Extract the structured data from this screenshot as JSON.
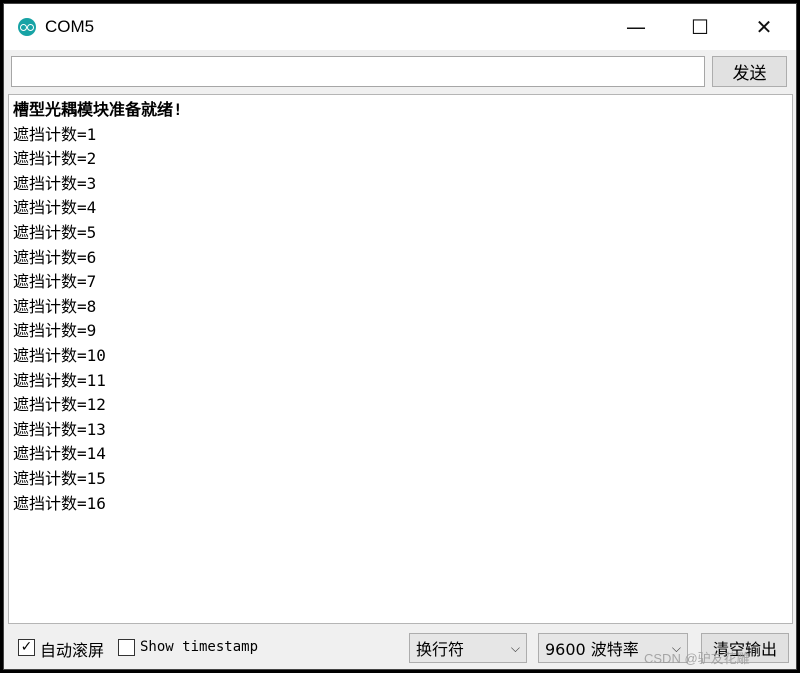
{
  "window": {
    "title": "COM5",
    "app_icon": "arduino-icon",
    "controls": {
      "minimize": "—",
      "maximize": "☐",
      "close": "✕"
    }
  },
  "send": {
    "input_value": "",
    "button_label": "发送"
  },
  "output": {
    "lines": [
      "槽型光耦模块准备就绪!",
      "遮挡计数=1",
      "遮挡计数=2",
      "遮挡计数=3",
      "遮挡计数=4",
      "遮挡计数=5",
      "遮挡计数=6",
      "遮挡计数=7",
      "遮挡计数=8",
      "遮挡计数=9",
      "遮挡计数=10",
      "遮挡计数=11",
      "遮挡计数=12",
      "遮挡计数=13",
      "遮挡计数=14",
      "遮挡计数=15",
      "遮挡计数=16"
    ]
  },
  "footer": {
    "autoscroll_label": "自动滚屏",
    "autoscroll_checked": true,
    "timestamp_label": "Show timestamp",
    "timestamp_checked": false,
    "line_ending": "换行符",
    "baud_rate": "9600 波特率",
    "clear_label": "清空输出",
    "watermark": "CSDN @驴友花雕"
  }
}
